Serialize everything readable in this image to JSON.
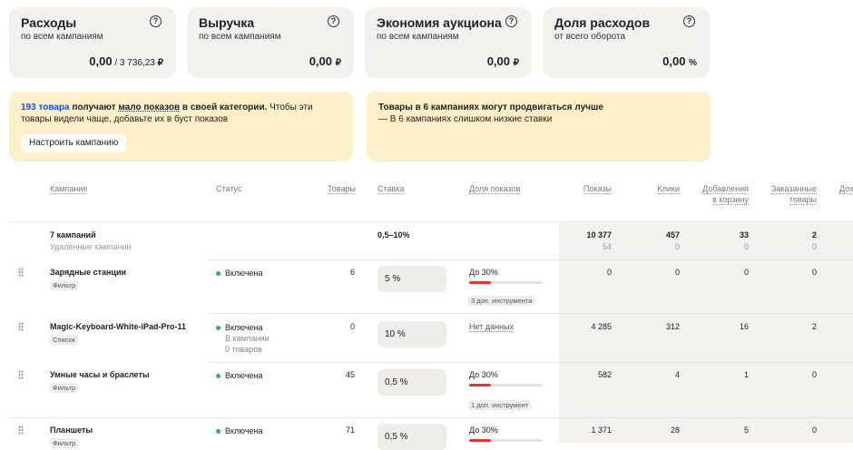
{
  "cards": [
    {
      "title": "Расходы",
      "subtitle": "по всем кампаниям",
      "value": "0,00",
      "value_of": " / 3 736,23 ",
      "currency": "₽"
    },
    {
      "title": "Выручка",
      "subtitle": "по всем кампаниям",
      "value": "0,00",
      "currency": "₽"
    },
    {
      "title": "Экономия аукциона",
      "subtitle": "по всем кампаниям",
      "value": "0,00",
      "currency": "₽"
    },
    {
      "title": "Доля расходов",
      "subtitle": "от всего оборота",
      "value": "0,00",
      "currency": "%"
    }
  ],
  "help_glyph": "?",
  "banner1": {
    "link": "193 товара",
    "text1": " получают ",
    "emph": "мало показов",
    "text2": " в своей категории.",
    "text3": " Чтобы эти товары видели чаще, добавьте их в буст показов",
    "button": "Настроить кампанию"
  },
  "banner2": {
    "title": "Товары в 6 кампаниях могут продвигаться лучше",
    "line": "— В 6 кампаниях слишком низкие ставки"
  },
  "headers": {
    "campaign": "Кампания",
    "status": "Статус",
    "goods": "Товары",
    "rate": "Ставка",
    "share": "Доля показов",
    "impressions": "Показы",
    "clicks": "Клики",
    "cart1": "Добавления",
    "cart2": "в корзину",
    "ordered1": "Заказанные",
    "ordered2": "товары",
    "more": "Дох"
  },
  "summary": {
    "name": "7 кампаний",
    "sub": "Удалённые кампании",
    "rate": "0,5–10%",
    "impressions": "10 377",
    "impressions_sub": "54",
    "clicks": "457",
    "clicks_sub": "0",
    "cart": "33",
    "cart_sub": "0",
    "ordered": "2",
    "ordered_sub": "0"
  },
  "rows": [
    {
      "name": "Зарядные станции",
      "tag": "Фильтр",
      "status": "Включена",
      "status_extra": [],
      "goods": "6",
      "rate": "5 %",
      "share": "До 30%",
      "share_fill": 0.3,
      "tools": "3 доп. инструмента",
      "impressions": "0",
      "clicks": "0",
      "cart": "0",
      "ordered": "0"
    },
    {
      "name": "Magic-Keyboard-White-iPad-Pro-11",
      "tag": "Список",
      "status": "Включена",
      "status_extra": [
        "В кампании",
        "0 товаров"
      ],
      "goods": "0",
      "rate": "10 %",
      "share": "Нет данных",
      "share_fill": null,
      "tools": "",
      "impressions": "4 285",
      "clicks": "312",
      "cart": "16",
      "ordered": "2"
    },
    {
      "name": "Умные часы и браслеты",
      "tag": "Фильтр",
      "status": "Включена",
      "status_extra": [],
      "goods": "45",
      "rate": "0,5 %",
      "share": "До 30%",
      "share_fill": 0.3,
      "tools": "1 доп. инструмент",
      "impressions": "582",
      "clicks": "4",
      "cart": "1",
      "ordered": "0"
    },
    {
      "name": "Планшеты",
      "tag": "Фильтр",
      "status": "Включена",
      "status_extra": [],
      "goods": "71",
      "rate": "0,5 %",
      "share": "До 30%",
      "share_fill": 0.3,
      "tools": "",
      "impressions": "1 371",
      "clicks": "28",
      "cart": "5",
      "ordered": "0"
    }
  ]
}
